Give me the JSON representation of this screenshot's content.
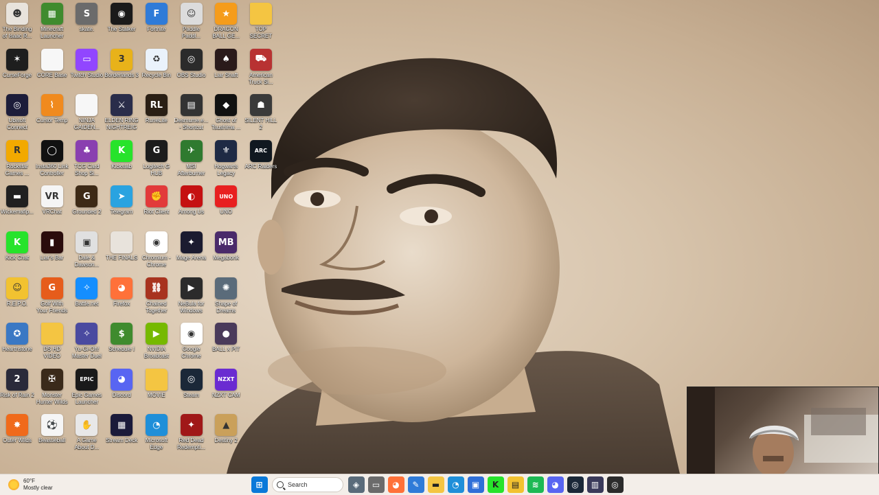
{
  "desktop": {
    "icons": [
      {
        "label": "The Binding of Isaac R...",
        "icon": "binding-of-isaac-icon",
        "color": "#e8e3dc",
        "glyph": "☻"
      },
      {
        "label": "Minecraft Launcher",
        "icon": "minecraft-icon",
        "color": "#3f8b2e",
        "glyph": "▦"
      },
      {
        "label": "skate.",
        "icon": "skate-icon",
        "color": "#6b6b6b",
        "glyph": "S"
      },
      {
        "label": "The Stalker",
        "icon": "stalker-icon",
        "color": "#1a1a1a",
        "glyph": "◉"
      },
      {
        "label": "Fortnite",
        "icon": "fortnite-icon",
        "color": "#2f7bd8",
        "glyph": "F"
      },
      {
        "label": "Paddle Paddl...",
        "icon": "paddle-icon",
        "color": "#dcdcdc",
        "glyph": "☺"
      },
      {
        "label": "DRAGON BALL GE...",
        "icon": "dragonball-icon",
        "color": "#f59c1b",
        "glyph": "★"
      },
      {
        "label": "TOP SECRET",
        "icon": "folder-icon",
        "color": "#f4c542",
        "glyph": ""
      },
      {
        "label": "CurseForge",
        "icon": "curseforge-icon",
        "color": "#1e1e1e",
        "glyph": "✶"
      },
      {
        "label": "CORE Base",
        "icon": "file-icon",
        "color": "#f7f7f7",
        "glyph": ""
      },
      {
        "label": "Twitch Studio",
        "icon": "twitch-icon",
        "color": "#9146ff",
        "glyph": "▭"
      },
      {
        "label": "Borderlands 3",
        "icon": "borderlands-icon",
        "color": "#e8b21a",
        "glyph": "3"
      },
      {
        "label": "Recycle Bin",
        "icon": "recycle-bin-icon",
        "color": "#eaf2fb",
        "glyph": "♻"
      },
      {
        "label": "OBS Studio",
        "icon": "obs-icon",
        "color": "#2b2b2b",
        "glyph": "◎"
      },
      {
        "label": "Liar Shaft",
        "icon": "liar-shaft-icon",
        "color": "#2a1a1a",
        "glyph": "♠"
      },
      {
        "label": "American Truck Si...",
        "icon": "truck-icon",
        "color": "#b83232",
        "glyph": "⛟"
      },
      {
        "label": "Ubisoft Connect",
        "icon": "ubisoft-icon",
        "color": "#1d1d3a",
        "glyph": "◎"
      },
      {
        "label": "Cursor Temp",
        "icon": "cursor-temp-icon",
        "color": "#f08a1e",
        "glyph": "⌇"
      },
      {
        "label": "NINJA GAIDEN...",
        "icon": "file-icon",
        "color": "#f7f7f7",
        "glyph": ""
      },
      {
        "label": "ELDEN RING NIGHTREIGN",
        "icon": "elden-ring-icon",
        "color": "#2a2d4a",
        "glyph": "⚔"
      },
      {
        "label": "RuneLite",
        "icon": "runelite-icon",
        "color": "#2a1f14",
        "glyph": "RL"
      },
      {
        "label": "Desmume.e... - Shortcut",
        "icon": "desmume-icon",
        "color": "#333",
        "glyph": "▤"
      },
      {
        "label": "Ghost of Tsushima ...",
        "icon": "ghost-tsushima-icon",
        "color": "#111",
        "glyph": "◆"
      },
      {
        "label": "SILENT HILL 2",
        "icon": "silent-hill-icon",
        "color": "#3a3a3a",
        "glyph": "☗"
      },
      {
        "label": "Rockstar Games ...",
        "icon": "rockstar-icon",
        "color": "#f2a900",
        "glyph": "R"
      },
      {
        "label": "Insta360 Link Controller",
        "icon": "insta360-icon",
        "color": "#111",
        "glyph": "◯"
      },
      {
        "label": "TCG Card Shop Si...",
        "icon": "tcg-card-icon",
        "color": "#8a3fb0",
        "glyph": "♣"
      },
      {
        "label": "Kickslab",
        "icon": "kick-icon",
        "color": "#27e32b",
        "glyph": "K"
      },
      {
        "label": "Logitech G HUB",
        "icon": "logitech-icon",
        "color": "#1c1c1c",
        "glyph": "G"
      },
      {
        "label": "MSI Afterburner",
        "icon": "msi-icon",
        "color": "#2f7a2f",
        "glyph": "✈"
      },
      {
        "label": "Hogwarts Legacy",
        "icon": "hogwarts-icon",
        "color": "#1e2a44",
        "glyph": "⚜"
      },
      {
        "label": "ARC Raiders",
        "icon": "arc-raiders-icon",
        "color": "#101820",
        "glyph": "ARC"
      },
      {
        "label": "Wickemafip...",
        "icon": "app-icon",
        "color": "#202020",
        "glyph": "▬"
      },
      {
        "label": "VRChat",
        "icon": "vrchat-icon",
        "color": "#f5f5f5",
        "glyph": "VR"
      },
      {
        "label": "Grounded 2",
        "icon": "grounded-icon",
        "color": "#3d2a16",
        "glyph": "G"
      },
      {
        "label": "Telegram",
        "icon": "telegram-icon",
        "color": "#2aa3e0",
        "glyph": "➤"
      },
      {
        "label": "Riot Client",
        "icon": "riot-icon",
        "color": "#e23a3a",
        "glyph": "✊"
      },
      {
        "label": "Among Us",
        "icon": "among-us-icon",
        "color": "#c51111",
        "glyph": "◐"
      },
      {
        "label": "UNO",
        "icon": "uno-icon",
        "color": "#e82020",
        "glyph": "UNO"
      },
      {
        "label": "Kick Chat",
        "icon": "kick-chat-icon",
        "color": "#27e32b",
        "glyph": "K"
      },
      {
        "label": "Liar's Bar",
        "icon": "liars-bar-icon",
        "color": "#2a0c0c",
        "glyph": "▮"
      },
      {
        "label": "Dale & Dawson...",
        "icon": "dale-dawson-icon",
        "color": "#e0e0e0",
        "glyph": "▣"
      },
      {
        "label": "THE FINALS",
        "icon": "the-finals-icon",
        "color": "#e8e3dc",
        "glyph": ""
      },
      {
        "label": "Chromium - Chrome",
        "icon": "chrome-icon",
        "color": "#ffffff",
        "glyph": "◉"
      },
      {
        "label": "Mage Arena",
        "icon": "mage-arena-icon",
        "color": "#1b1b30",
        "glyph": "✦"
      },
      {
        "label": "Megabonk",
        "icon": "megabonk-icon",
        "color": "#4a2a6a",
        "glyph": "MB"
      },
      {
        "label": "R.E.P.O.",
        "icon": "repo-icon",
        "color": "#f2c230",
        "glyph": "☺"
      },
      {
        "label": "Golf With Your Friends",
        "icon": "golf-icon",
        "color": "#e65c1b",
        "glyph": "G"
      },
      {
        "label": "Battle.net",
        "icon": "battlenet-icon",
        "color": "#148eff",
        "glyph": "✧"
      },
      {
        "label": "Firefox",
        "icon": "firefox-icon",
        "color": "#ff7139",
        "glyph": "◕"
      },
      {
        "label": "Chained Together",
        "icon": "chained-together-icon",
        "color": "#a8331f",
        "glyph": "⛓"
      },
      {
        "label": "NeBula for Windows",
        "icon": "nebula-icon",
        "color": "#2b2b2b",
        "glyph": "▶"
      },
      {
        "label": "Shape of Dreams",
        "icon": "shape-dreams-icon",
        "color": "#5a6b7a",
        "glyph": "✺"
      },
      {
        "label": "Hearthstone",
        "icon": "hearthstone-icon",
        "color": "#3a78c4",
        "glyph": "✪"
      },
      {
        "label": "DS HD VIDEO",
        "icon": "folder-icon",
        "color": "#f4c542",
        "glyph": ""
      },
      {
        "label": "Yu-Gi-Oh! Master Duel",
        "icon": "yugioh-icon",
        "color": "#4a4aa0",
        "glyph": "✧"
      },
      {
        "label": "Schedule I",
        "icon": "schedule-icon",
        "color": "#3f8b2e",
        "glyph": "$"
      },
      {
        "label": "NVIDIA Broadcast",
        "icon": "nvidia-icon",
        "color": "#76b900",
        "glyph": "▶"
      },
      {
        "label": "Google Chrome",
        "icon": "chrome-icon",
        "color": "#ffffff",
        "glyph": "◉"
      },
      {
        "label": "BALL x PIT",
        "icon": "ball-pit-icon",
        "color": "#4a3a5a",
        "glyph": "●"
      },
      {
        "label": "Risk of Rain 2",
        "icon": "risk-rain-icon",
        "color": "#2a2a3a",
        "glyph": "2"
      },
      {
        "label": "Monster Hunter Wilds",
        "icon": "monster-hunter-icon",
        "color": "#3a2a1a",
        "glyph": "✠"
      },
      {
        "label": "Epic Games Launcher",
        "icon": "epic-games-icon",
        "color": "#1a1a1a",
        "glyph": "EPIC"
      },
      {
        "label": "Discord",
        "icon": "discord-icon",
        "color": "#5865f2",
        "glyph": "◕"
      },
      {
        "label": "MOVIE",
        "icon": "folder-icon",
        "color": "#f4c542",
        "glyph": ""
      },
      {
        "label": "Steam",
        "icon": "steam-icon",
        "color": "#1b2838",
        "glyph": "◎"
      },
      {
        "label": "NZXT CAM",
        "icon": "nzxt-icon",
        "color": "#6a2bd1",
        "glyph": "NZXT"
      },
      {
        "label": "Outer Wilds",
        "icon": "outer-wilds-icon",
        "color": "#f06a1b",
        "glyph": "✸"
      },
      {
        "label": "Beastieball",
        "icon": "beastieball-icon",
        "color": "#f5f5f5",
        "glyph": "⚽"
      },
      {
        "label": "A Game About D...",
        "icon": "game-about-icon",
        "color": "#e8e8e8",
        "glyph": "✋"
      },
      {
        "label": "Stream Deck",
        "icon": "stream-deck-icon",
        "color": "#1a1a3a",
        "glyph": "▦"
      },
      {
        "label": "Microsoft Edge",
        "icon": "edge-icon",
        "color": "#1f8fd9",
        "glyph": "◔"
      },
      {
        "label": "Red Dead Redempti...",
        "icon": "red-dead-icon",
        "color": "#a01818",
        "glyph": "✦"
      },
      {
        "label": "Destiny 2",
        "icon": "destiny-icon",
        "color": "#caa05a",
        "glyph": "▲"
      }
    ]
  },
  "taskbar": {
    "weather": {
      "temp": "60°F",
      "condition": "Mostly clear",
      "icon": "weather-sun-icon"
    },
    "search_label": "Search",
    "pinned": [
      {
        "icon": "windows-start-icon",
        "color": "#0a79d9",
        "glyph": "⊞"
      },
      {
        "icon": "search-icon",
        "kind": "search"
      },
      {
        "icon": "widgets-icon",
        "color": "#5a6b7a",
        "glyph": "◈"
      },
      {
        "icon": "task-view-icon",
        "color": "#6b6b6b",
        "glyph": "▭"
      },
      {
        "icon": "firefox-icon",
        "color": "#ff7139",
        "glyph": "◕"
      },
      {
        "icon": "paint-icon",
        "color": "#2f7bd8",
        "glyph": "✎"
      },
      {
        "icon": "file-explorer-icon",
        "color": "#f4c542",
        "glyph": "▬"
      },
      {
        "icon": "edge-icon",
        "color": "#1f8fd9",
        "glyph": "◔"
      },
      {
        "icon": "store-icon",
        "color": "#2f6fd8",
        "glyph": "▣"
      },
      {
        "icon": "kick-icon",
        "color": "#27e32b",
        "glyph": "K"
      },
      {
        "icon": "sticky-notes-icon",
        "color": "#f2c230",
        "glyph": "▤"
      },
      {
        "icon": "spotify-icon",
        "color": "#1db954",
        "glyph": "≋"
      },
      {
        "icon": "discord-icon",
        "color": "#5865f2",
        "glyph": "◕"
      },
      {
        "icon": "steam-icon",
        "color": "#1b2838",
        "glyph": "◎"
      },
      {
        "icon": "app-icon",
        "color": "#3a3a5a",
        "glyph": "▥"
      },
      {
        "icon": "obs-icon",
        "color": "#2b2b2b",
        "glyph": "◎"
      }
    ]
  }
}
